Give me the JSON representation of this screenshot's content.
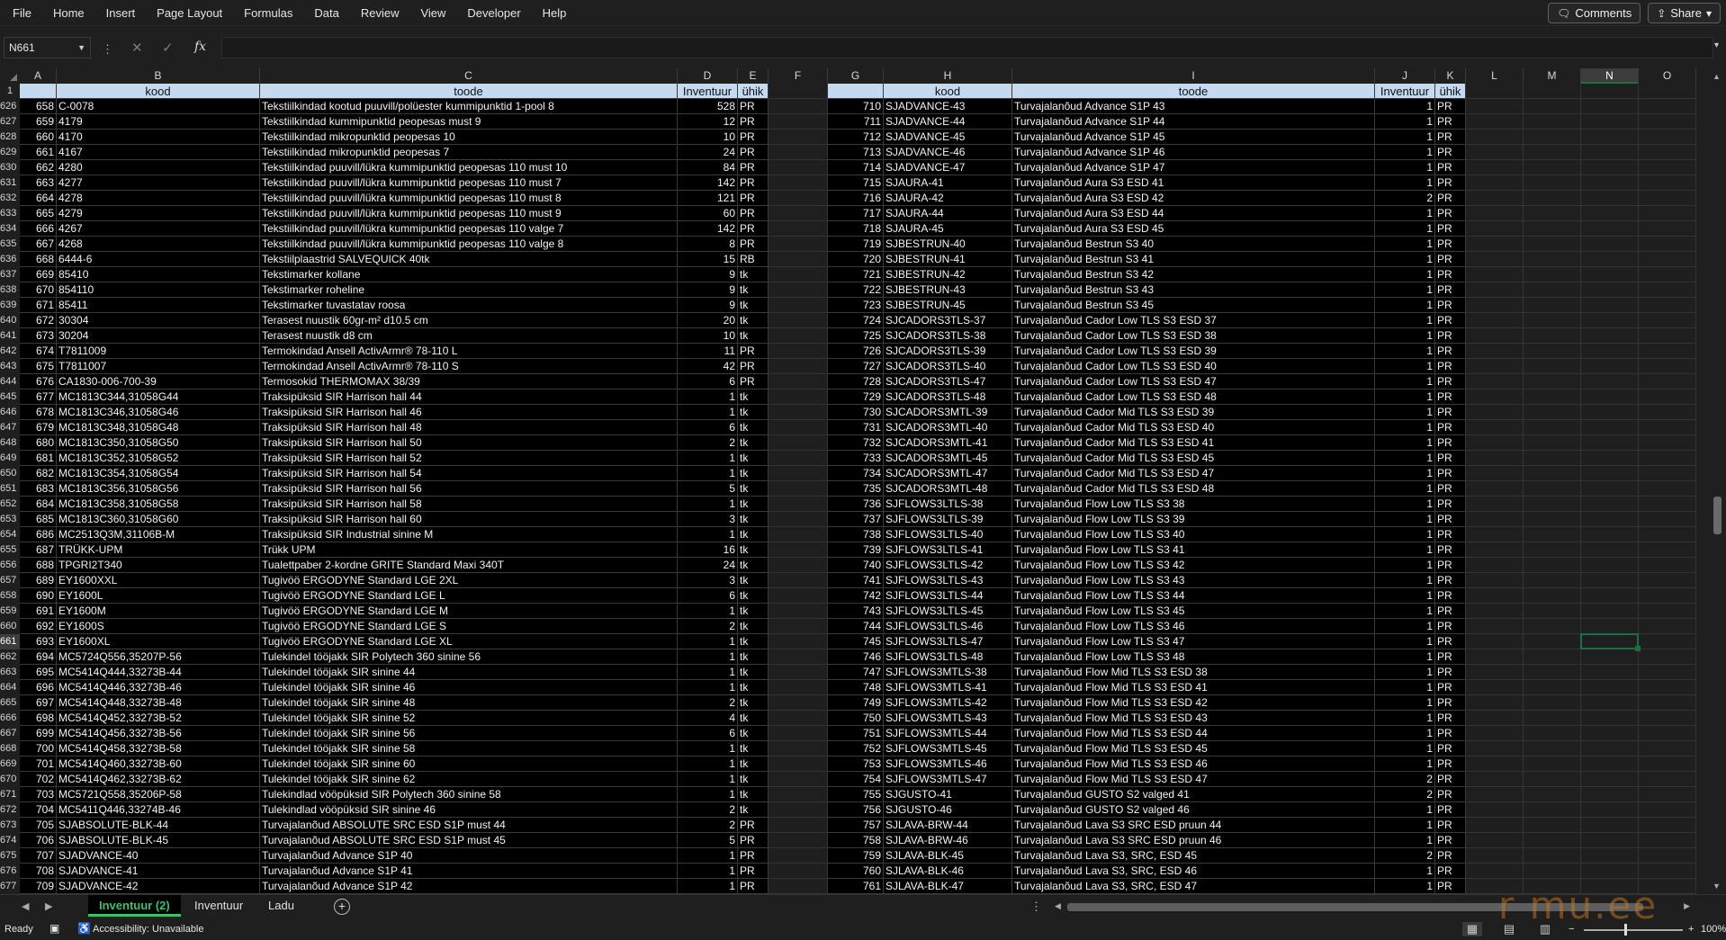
{
  "menu": [
    "File",
    "Home",
    "Insert",
    "Page Layout",
    "Formulas",
    "Data",
    "Review",
    "View",
    "Developer",
    "Help"
  ],
  "top_buttons": {
    "comments": "Comments",
    "share": "Share"
  },
  "formula_bar": {
    "name_box": "N661",
    "cancel_icon": "✕",
    "enter_icon": "✓",
    "fx_icon": "fx",
    "value": ""
  },
  "columns": [
    "A",
    "B",
    "C",
    "D",
    "E",
    "F",
    "G",
    "H",
    "I",
    "J",
    "K",
    "L",
    "M",
    "N",
    "O"
  ],
  "selected_column": "N",
  "header_row": {
    "row": "1",
    "left": [
      "",
      "kood",
      "toode",
      "Inventuur",
      "ühik"
    ],
    "right": [
      "",
      "kood",
      "toode",
      "Inventuur",
      "ühik"
    ]
  },
  "rows": [
    {
      "r": "626",
      "L": [
        "658",
        "C-0078",
        "Tekstiilkindad kootud puuvill/polüester kummipunktid 1-pool 8",
        "528",
        "PR"
      ],
      "R": [
        "710",
        "SJADVANCE-43",
        "Turvajalanõud Advance S1P 43",
        "1",
        "PR"
      ]
    },
    {
      "r": "627",
      "L": [
        "659",
        "4179",
        "Tekstiilkindad kummipunktid peopesas must 9",
        "12",
        "PR"
      ],
      "R": [
        "711",
        "SJADVANCE-44",
        "Turvajalanõud Advance S1P 44",
        "1",
        "PR"
      ]
    },
    {
      "r": "628",
      "L": [
        "660",
        "4170",
        "Tekstiilkindad mikropunktid peopesas 10",
        "10",
        "PR"
      ],
      "R": [
        "712",
        "SJADVANCE-45",
        "Turvajalanõud Advance S1P 45",
        "1",
        "PR"
      ]
    },
    {
      "r": "629",
      "L": [
        "661",
        "4167",
        "Tekstiilkindad mikropunktid peopesas 7",
        "24",
        "PR"
      ],
      "R": [
        "713",
        "SJADVANCE-46",
        "Turvajalanõud Advance S1P 46",
        "1",
        "PR"
      ]
    },
    {
      "r": "630",
      "L": [
        "662",
        "4280",
        "Tekstiilkindad puuvill/lükra kummipunktid peopesas 110 must 10",
        "84",
        "PR"
      ],
      "R": [
        "714",
        "SJADVANCE-47",
        "Turvajalanõud Advance S1P 47",
        "1",
        "PR"
      ]
    },
    {
      "r": "631",
      "L": [
        "663",
        "4277",
        "Tekstiilkindad puuvill/lükra kummipunktid peopesas 110 must 7",
        "142",
        "PR"
      ],
      "R": [
        "715",
        "SJAURA-41",
        "Turvajalanõud Aura S3 ESD 41",
        "1",
        "PR"
      ]
    },
    {
      "r": "632",
      "L": [
        "664",
        "4278",
        "Tekstiilkindad puuvill/lükra kummipunktid peopesas 110 must 8",
        "121",
        "PR"
      ],
      "R": [
        "716",
        "SJAURA-42",
        "Turvajalanõud Aura S3 ESD 42",
        "2",
        "PR"
      ]
    },
    {
      "r": "633",
      "L": [
        "665",
        "4279",
        "Tekstiilkindad puuvill/lükra kummipunktid peopesas 110 must 9",
        "60",
        "PR"
      ],
      "R": [
        "717",
        "SJAURA-44",
        "Turvajalanõud Aura S3 ESD 44",
        "1",
        "PR"
      ]
    },
    {
      "r": "634",
      "L": [
        "666",
        "4267",
        "Tekstiilkindad puuvill/lükra kummipunktid peopesas 110 valge 7",
        "142",
        "PR"
      ],
      "R": [
        "718",
        "SJAURA-45",
        "Turvajalanõud Aura S3 ESD 45",
        "1",
        "PR"
      ]
    },
    {
      "r": "635",
      "L": [
        "667",
        "4268",
        "Tekstiilkindad puuvill/lükra kummipunktid peopesas 110 valge 8",
        "8",
        "PR"
      ],
      "R": [
        "719",
        "SJBESTRUN-40",
        "Turvajalanõud Bestrun S3 40",
        "1",
        "PR"
      ]
    },
    {
      "r": "636",
      "L": [
        "668",
        "6444-6",
        "Tekstiilplaastrid SALVEQUICK 40tk",
        "15",
        "RB"
      ],
      "R": [
        "720",
        "SJBESTRUN-41",
        "Turvajalanõud Bestrun S3 41",
        "1",
        "PR"
      ]
    },
    {
      "r": "637",
      "L": [
        "669",
        "85410",
        "Tekstimarker kollane",
        "9",
        "tk"
      ],
      "R": [
        "721",
        "SJBESTRUN-42",
        "Turvajalanõud Bestrun S3 42",
        "1",
        "PR"
      ]
    },
    {
      "r": "638",
      "L": [
        "670",
        "854110",
        "Tekstimarker roheline",
        "9",
        "tk"
      ],
      "R": [
        "722",
        "SJBESTRUN-43",
        "Turvajalanõud Bestrun S3 43",
        "1",
        "PR"
      ]
    },
    {
      "r": "639",
      "L": [
        "671",
        "85411",
        "Tekstimarker tuvastatav roosa",
        "9",
        "tk"
      ],
      "R": [
        "723",
        "SJBESTRUN-45",
        "Turvajalanõud Bestrun S3 45",
        "1",
        "PR"
      ]
    },
    {
      "r": "640",
      "L": [
        "672",
        "30304",
        "Terasest nuustik 60gr-m² d10.5 cm",
        "20",
        "tk"
      ],
      "R": [
        "724",
        "SJCADORS3TLS-37",
        "Turvajalanõud Cador Low TLS S3 ESD 37",
        "1",
        "PR"
      ]
    },
    {
      "r": "641",
      "L": [
        "673",
        "30204",
        "Terasest nuustik d8 cm",
        "10",
        "tk"
      ],
      "R": [
        "725",
        "SJCADORS3TLS-38",
        "Turvajalanõud Cador Low TLS S3 ESD 38",
        "1",
        "PR"
      ]
    },
    {
      "r": "642",
      "L": [
        "674",
        "T7811009",
        "Termokindad Ansell ActivArmr® 78-110 L",
        "11",
        "PR"
      ],
      "R": [
        "726",
        "SJCADORS3TLS-39",
        "Turvajalanõud Cador Low TLS S3 ESD 39",
        "1",
        "PR"
      ]
    },
    {
      "r": "643",
      "L": [
        "675",
        "T7811007",
        "Termokindad Ansell ActivArmr® 78-110 S",
        "42",
        "PR"
      ],
      "R": [
        "727",
        "SJCADORS3TLS-40",
        "Turvajalanõud Cador Low TLS S3 ESD 40",
        "1",
        "PR"
      ]
    },
    {
      "r": "644",
      "L": [
        "676",
        "CA1830-006-700-39",
        "Termosokid THERMOMAX 38/39",
        "6",
        "PR"
      ],
      "R": [
        "728",
        "SJCADORS3TLS-47",
        "Turvajalanõud Cador Low TLS S3 ESD 47",
        "1",
        "PR"
      ]
    },
    {
      "r": "645",
      "L": [
        "677",
        "MC1813C344,31058G44",
        "Traksipüksid SIR Harrison hall 44",
        "1",
        "tk"
      ],
      "R": [
        "729",
        "SJCADORS3TLS-48",
        "Turvajalanõud Cador Low TLS S3 ESD 48",
        "1",
        "PR"
      ]
    },
    {
      "r": "646",
      "L": [
        "678",
        "MC1813C346,31058G46",
        "Traksipüksid SIR Harrison hall 46",
        "1",
        "tk"
      ],
      "R": [
        "730",
        "SJCADORS3MTL-39",
        "Turvajalanõud Cador Mid TLS S3 ESD 39",
        "1",
        "PR"
      ]
    },
    {
      "r": "647",
      "L": [
        "679",
        "MC1813C348,31058G48",
        "Traksipüksid SIR Harrison hall 48",
        "6",
        "tk"
      ],
      "R": [
        "731",
        "SJCADORS3MTL-40",
        "Turvajalanõud Cador Mid TLS S3 ESD 40",
        "1",
        "PR"
      ]
    },
    {
      "r": "648",
      "L": [
        "680",
        "MC1813C350,31058G50",
        "Traksipüksid SIR Harrison hall 50",
        "2",
        "tk"
      ],
      "R": [
        "732",
        "SJCADORS3MTL-41",
        "Turvajalanõud Cador Mid TLS S3 ESD 41",
        "1",
        "PR"
      ]
    },
    {
      "r": "649",
      "L": [
        "681",
        "MC1813C352,31058G52",
        "Traksipüksid SIR Harrison hall 52",
        "1",
        "tk"
      ],
      "R": [
        "733",
        "SJCADORS3MTL-45",
        "Turvajalanõud Cador Mid TLS S3 ESD 45",
        "1",
        "PR"
      ]
    },
    {
      "r": "650",
      "L": [
        "682",
        "MC1813C354,31058G54",
        "Traksipüksid SIR Harrison hall 54",
        "1",
        "tk"
      ],
      "R": [
        "734",
        "SJCADORS3MTL-47",
        "Turvajalanõud Cador Mid TLS S3 ESD 47",
        "1",
        "PR"
      ]
    },
    {
      "r": "651",
      "L": [
        "683",
        "MC1813C356,31058G56",
        "Traksipüksid SIR Harrison hall 56",
        "5",
        "tk"
      ],
      "R": [
        "735",
        "SJCADORS3MTL-48",
        "Turvajalanõud Cador Mid TLS S3 ESD 48",
        "1",
        "PR"
      ]
    },
    {
      "r": "652",
      "L": [
        "684",
        "MC1813C358,31058G58",
        "Traksipüksid SIR Harrison hall 58",
        "1",
        "tk"
      ],
      "R": [
        "736",
        "SJFLOWS3LTLS-38",
        "Turvajalanõud Flow Low TLS S3 38",
        "1",
        "PR"
      ]
    },
    {
      "r": "653",
      "L": [
        "685",
        "MC1813C360,31058G60",
        "Traksipüksid SIR Harrison hall 60",
        "3",
        "tk"
      ],
      "R": [
        "737",
        "SJFLOWS3LTLS-39",
        "Turvajalanõud Flow Low TLS S3 39",
        "1",
        "PR"
      ]
    },
    {
      "r": "654",
      "L": [
        "686",
        "MC2513Q3M,31106B-M",
        "Traksipüksid SIR Industrial sinine M",
        "1",
        "tk"
      ],
      "R": [
        "738",
        "SJFLOWS3LTLS-40",
        "Turvajalanõud Flow Low TLS S3 40",
        "1",
        "PR"
      ]
    },
    {
      "r": "655",
      "L": [
        "687",
        "TRÜKK-UPM",
        "Trükk UPM",
        "16",
        "tk"
      ],
      "R": [
        "739",
        "SJFLOWS3LTLS-41",
        "Turvajalanõud Flow Low TLS S3 41",
        "1",
        "PR"
      ]
    },
    {
      "r": "656",
      "L": [
        "688",
        "TPGRI2T340",
        "Tualettpaber 2-kordne GRITE Standard Maxi 340T",
        "24",
        "tk"
      ],
      "R": [
        "740",
        "SJFLOWS3LTLS-42",
        "Turvajalanõud Flow Low TLS S3 42",
        "1",
        "PR"
      ]
    },
    {
      "r": "657",
      "L": [
        "689",
        "EY1600XXL",
        "Tugivöö ERGODYNE Standard LGE 2XL",
        "3",
        "tk"
      ],
      "R": [
        "741",
        "SJFLOWS3LTLS-43",
        "Turvajalanõud Flow Low TLS S3 43",
        "1",
        "PR"
      ]
    },
    {
      "r": "658",
      "L": [
        "690",
        "EY1600L",
        "Tugivöö ERGODYNE Standard LGE L",
        "6",
        "tk"
      ],
      "R": [
        "742",
        "SJFLOWS3LTLS-44",
        "Turvajalanõud Flow Low TLS S3 44",
        "1",
        "PR"
      ]
    },
    {
      "r": "659",
      "L": [
        "691",
        "EY1600M",
        "Tugivöö ERGODYNE Standard LGE M",
        "1",
        "tk"
      ],
      "R": [
        "743",
        "SJFLOWS3LTLS-45",
        "Turvajalanõud Flow Low TLS S3 45",
        "1",
        "PR"
      ]
    },
    {
      "r": "660",
      "L": [
        "692",
        "EY1600S",
        "Tugivöö ERGODYNE Standard LGE S",
        "2",
        "tk"
      ],
      "R": [
        "744",
        "SJFLOWS3LTLS-46",
        "Turvajalanõud Flow Low TLS S3 46",
        "1",
        "PR"
      ]
    },
    {
      "r": "661",
      "L": [
        "693",
        "EY1600XL",
        "Tugivöö ERGODYNE Standard LGE XL",
        "1",
        "tk"
      ],
      "R": [
        "745",
        "SJFLOWS3LTLS-47",
        "Turvajalanõud Flow Low TLS S3 47",
        "1",
        "PR"
      ]
    },
    {
      "r": "662",
      "L": [
        "694",
        "MC5724Q556,35207P-56",
        "Tulekindel tööjakk SIR Polytech 360 sinine 56",
        "1",
        "tk"
      ],
      "R": [
        "746",
        "SJFLOWS3LTLS-48",
        "Turvajalanõud Flow Low TLS S3 48",
        "1",
        "PR"
      ]
    },
    {
      "r": "663",
      "L": [
        "695",
        "MC5414Q444,33273B-44",
        "Tulekindel tööjakk SIR sinine 44",
        "1",
        "tk"
      ],
      "R": [
        "747",
        "SJFLOWS3MTLS-38",
        "Turvajalanõud Flow Mid TLS S3 ESD 38",
        "1",
        "PR"
      ]
    },
    {
      "r": "664",
      "L": [
        "696",
        "MC5414Q446,33273B-46",
        "Tulekindel tööjakk SIR sinine 46",
        "1",
        "tk"
      ],
      "R": [
        "748",
        "SJFLOWS3MTLS-41",
        "Turvajalanõud Flow Mid TLS S3 ESD 41",
        "1",
        "PR"
      ]
    },
    {
      "r": "665",
      "L": [
        "697",
        "MC5414Q448,33273B-48",
        "Tulekindel tööjakk SIR sinine 48",
        "2",
        "tk"
      ],
      "R": [
        "749",
        "SJFLOWS3MTLS-42",
        "Turvajalanõud Flow Mid TLS S3 ESD 42",
        "1",
        "PR"
      ]
    },
    {
      "r": "666",
      "L": [
        "698",
        "MC5414Q452,33273B-52",
        "Tulekindel tööjakk SIR sinine 52",
        "4",
        "tk"
      ],
      "R": [
        "750",
        "SJFLOWS3MTLS-43",
        "Turvajalanõud Flow Mid TLS S3 ESD 43",
        "1",
        "PR"
      ]
    },
    {
      "r": "667",
      "L": [
        "699",
        "MC5414Q456,33273B-56",
        "Tulekindel tööjakk SIR sinine 56",
        "6",
        "tk"
      ],
      "R": [
        "751",
        "SJFLOWS3MTLS-44",
        "Turvajalanõud Flow Mid TLS S3 ESD 44",
        "1",
        "PR"
      ]
    },
    {
      "r": "668",
      "L": [
        "700",
        "MC5414Q458,33273B-58",
        "Tulekindel tööjakk SIR sinine 58",
        "1",
        "tk"
      ],
      "R": [
        "752",
        "SJFLOWS3MTLS-45",
        "Turvajalanõud Flow Mid TLS S3 ESD 45",
        "1",
        "PR"
      ]
    },
    {
      "r": "669",
      "L": [
        "701",
        "MC5414Q460,33273B-60",
        "Tulekindel tööjakk SIR sinine 60",
        "1",
        "tk"
      ],
      "R": [
        "753",
        "SJFLOWS3MTLS-46",
        "Turvajalanõud Flow Mid TLS S3 ESD 46",
        "1",
        "PR"
      ]
    },
    {
      "r": "670",
      "L": [
        "702",
        "MC5414Q462,33273B-62",
        "Tulekindel tööjakk SIR sinine 62",
        "1",
        "tk"
      ],
      "R": [
        "754",
        "SJFLOWS3MTLS-47",
        "Turvajalanõud Flow Mid TLS S3 ESD 47",
        "2",
        "PR"
      ]
    },
    {
      "r": "671",
      "L": [
        "703",
        "MC5721Q558,35206P-58",
        "Tulekindlad vööpüksid SIR Polytech 360 sinine 58",
        "1",
        "tk"
      ],
      "R": [
        "755",
        "SJGUSTO-41",
        "Turvajalanõud GUSTO S2 valged 41",
        "2",
        "PR"
      ]
    },
    {
      "r": "672",
      "L": [
        "704",
        "MC5411Q446,33274B-46",
        "Tulekindlad vööpüksid SIR sinine 46",
        "2",
        "tk"
      ],
      "R": [
        "756",
        "SJGUSTO-46",
        "Turvajalanõud GUSTO S2 valged 46",
        "1",
        "PR"
      ]
    },
    {
      "r": "673",
      "L": [
        "705",
        "SJABSOLUTE-BLK-44",
        "Turvajalanõud ABSOLUTE SRC ESD S1P must 44",
        "2",
        "PR"
      ],
      "R": [
        "757",
        "SJLAVA-BRW-44",
        "Turvajalanõud Lava S3 SRC ESD pruun 44",
        "1",
        "PR"
      ]
    },
    {
      "r": "674",
      "L": [
        "706",
        "SJABSOLUTE-BLK-45",
        "Turvajalanõud ABSOLUTE SRC ESD S1P must 45",
        "5",
        "PR"
      ],
      "R": [
        "758",
        "SJLAVA-BRW-46",
        "Turvajalanõud Lava S3 SRC ESD pruun 46",
        "1",
        "PR"
      ]
    },
    {
      "r": "675",
      "L": [
        "707",
        "SJADVANCE-40",
        "Turvajalanõud Advance S1P 40",
        "1",
        "PR"
      ],
      "R": [
        "759",
        "SJLAVA-BLK-45",
        "Turvajalanõud Lava S3, SRC, ESD 45",
        "2",
        "PR"
      ]
    },
    {
      "r": "676",
      "L": [
        "708",
        "SJADVANCE-41",
        "Turvajalanõud Advance S1P 41",
        "1",
        "PR"
      ],
      "R": [
        "760",
        "SJLAVA-BLK-46",
        "Turvajalanõud Lava S3, SRC, ESD 46",
        "1",
        "PR"
      ]
    },
    {
      "r": "677",
      "L": [
        "709",
        "SJADVANCE-42",
        "Turvajalanõud Advance S1P 42",
        "1",
        "PR"
      ],
      "R": [
        "761",
        "SJLAVA-BLK-47",
        "Turvajalanõud Lava S3, SRC, ESD 47",
        "1",
        "PR"
      ]
    }
  ],
  "selected_row": "661",
  "sheet_tabs": [
    {
      "label": "Inventuur (2)",
      "active": true
    },
    {
      "label": "Inventuur",
      "active": false
    },
    {
      "label": "Ladu",
      "active": false
    }
  ],
  "status": {
    "ready": "Ready",
    "accessibility": "Accessibility: Unavailable",
    "zoom": "100%"
  },
  "watermark": "r   mu.ee",
  "colors": {
    "header_fill": "#c5d9f1",
    "accent_green": "#1d6f42",
    "tab_green": "#3fbf6d"
  }
}
